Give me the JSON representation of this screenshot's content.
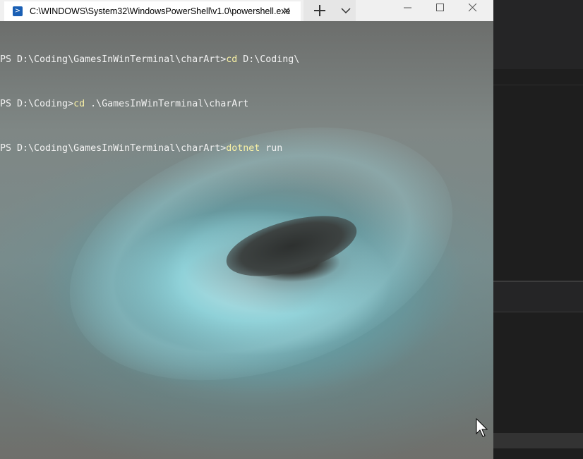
{
  "window": {
    "tab_title": "C:\\WINDOWS\\System32\\WindowsPowerShell\\v1.0\\powershell.exe",
    "tab_close": "✕",
    "icon": "powershell-icon"
  },
  "terminal": {
    "lines": [
      {
        "prompt": "PS D:\\Coding\\GamesInWinTerminal\\charArt>",
        "command": "cd",
        "args": " D:\\Coding\\"
      },
      {
        "prompt": "PS D:\\Coding>",
        "command": "cd",
        "args": " .\\GamesInWinTerminal\\charArt"
      },
      {
        "prompt": "PS D:\\Coding\\GamesInWinTerminal\\charArt>",
        "command": "dotnet",
        "args": " run"
      }
    ],
    "command_color": "#f9f1a5",
    "text_color": "#f2f2f2"
  },
  "colors": {
    "titlebar": "#f0f0f0",
    "tab_active": "#ffffff",
    "editor_bg": "#1e1e1e"
  }
}
